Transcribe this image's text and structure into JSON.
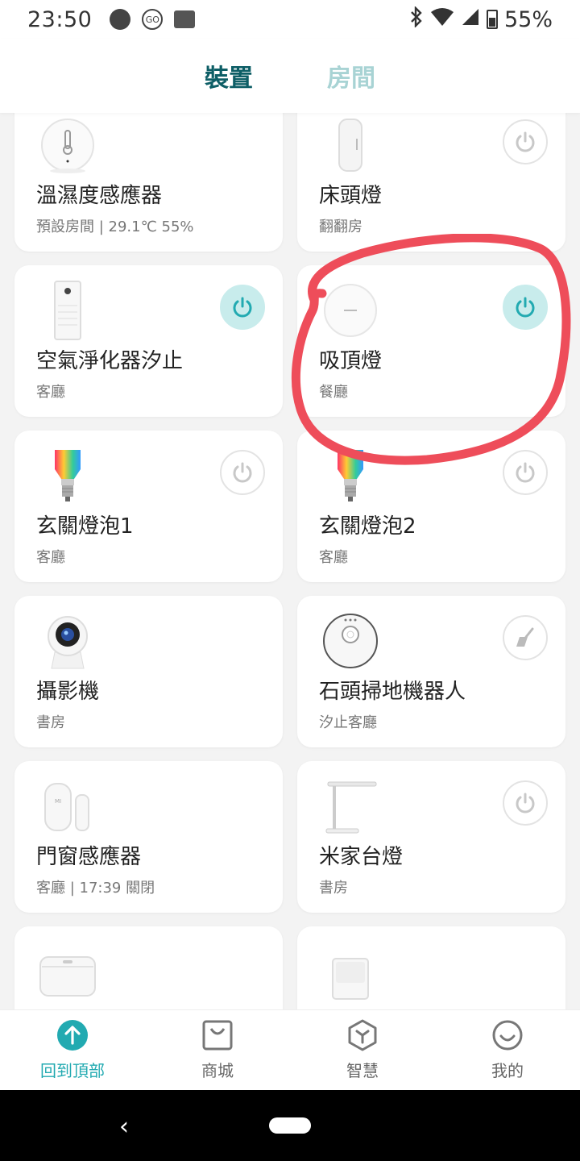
{
  "status_bar": {
    "time": "23:50",
    "battery": "55%",
    "icons": [
      "spotify-icon",
      "go-icon",
      "news-icon",
      "bluetooth-icon",
      "wifi-icon",
      "signal-icon",
      "battery-icon"
    ]
  },
  "header": {
    "tabs": [
      {
        "label": "裝置",
        "active": true
      },
      {
        "label": "房間",
        "active": false
      }
    ]
  },
  "devices": [
    {
      "name": "溫濕度感應器",
      "sub": "預設房間 | 29.1℃ 55%",
      "power": "none",
      "icon": "thermometer-icon"
    },
    {
      "name": "床頭燈",
      "sub": "翻翻房",
      "power": "off",
      "icon": "bedside-lamp-icon"
    },
    {
      "name": "空氣淨化器汐止",
      "sub": "客廳",
      "power": "on",
      "icon": "air-purifier-icon"
    },
    {
      "name": "吸頂燈",
      "sub": "餐廳",
      "power": "on",
      "icon": "ceiling-light-icon"
    },
    {
      "name": "玄關燈泡1",
      "sub": "客廳",
      "power": "off",
      "icon": "bulb-icon"
    },
    {
      "name": "玄關燈泡2",
      "sub": "客廳",
      "power": "off",
      "icon": "bulb-icon"
    },
    {
      "name": "攝影機",
      "sub": "書房",
      "power": "none",
      "icon": "camera-icon"
    },
    {
      "name": "石頭掃地機器人",
      "sub": "汐止客廳",
      "power": "sweep",
      "icon": "robot-vacuum-icon"
    },
    {
      "name": "門窗感應器",
      "sub": "客廳 | 17:39 關閉",
      "power": "none",
      "icon": "door-sensor-icon"
    },
    {
      "name": "米家台燈",
      "sub": "書房",
      "power": "off",
      "icon": "desk-lamp-icon"
    },
    {
      "name": "",
      "sub": "",
      "power": "none",
      "icon": "rice-cooker-icon"
    },
    {
      "name": "",
      "sub": "",
      "power": "none",
      "icon": "motion-sensor-icon"
    }
  ],
  "annotation": {
    "color": "#ee4d5a",
    "target": "吸頂燈"
  },
  "colors": {
    "accent": "#22aab1",
    "power_on_bg": "#c8ecec",
    "tab_active": "#0d5e66",
    "tab_inactive": "#a8d3d4"
  },
  "bottom_nav": [
    {
      "label": "回到頂部",
      "icon": "arrow-up-icon",
      "active": true
    },
    {
      "label": "商城",
      "icon": "shop-bag-icon",
      "active": false
    },
    {
      "label": "智慧",
      "icon": "smart-hex-icon",
      "active": false
    },
    {
      "label": "我的",
      "icon": "profile-smile-icon",
      "active": false
    }
  ]
}
